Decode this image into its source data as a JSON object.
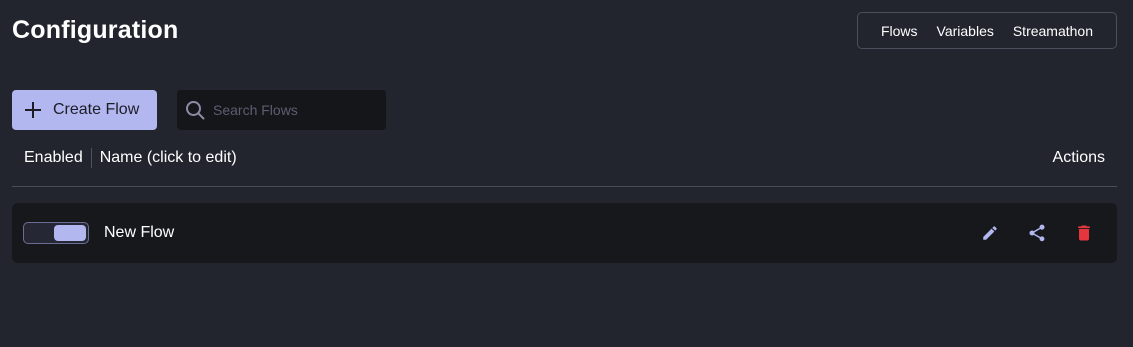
{
  "page": {
    "title": "Configuration"
  },
  "nav": {
    "items": [
      {
        "label": "Flows"
      },
      {
        "label": "Variables"
      },
      {
        "label": "Streamathon"
      }
    ]
  },
  "toolbar": {
    "create_label": "Create Flow",
    "create_icon": "plus-icon",
    "search_placeholder": "Search Flows",
    "search_value": "",
    "search_icon": "search-icon"
  },
  "table": {
    "headers": {
      "enabled": "Enabled",
      "name": "Name (click to edit)",
      "actions": "Actions"
    },
    "rows": [
      {
        "enabled": true,
        "name": "New Flow",
        "actions": [
          "edit-icon",
          "share-icon",
          "delete-icon"
        ]
      }
    ]
  },
  "colors": {
    "background": "#22242e",
    "accent": "#b3b7f0",
    "row_background": "#17181c",
    "delete": "#e5363d"
  }
}
